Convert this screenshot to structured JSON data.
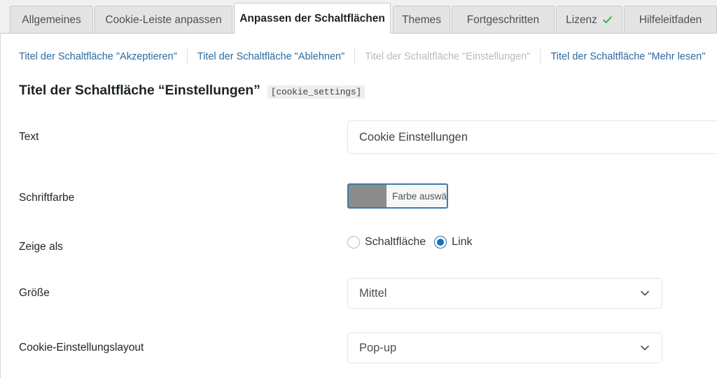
{
  "tabs": [
    {
      "label": "Allgemeines",
      "active": false,
      "icon": null
    },
    {
      "label": "Cookie-Leiste anpassen",
      "active": false,
      "icon": null
    },
    {
      "label": "Anpassen der Schaltflächen",
      "active": true,
      "icon": null
    },
    {
      "label": "Themes",
      "active": false,
      "icon": null
    },
    {
      "label": "Fortgeschritten",
      "active": false,
      "icon": null
    },
    {
      "label": "Lizenz",
      "active": false,
      "icon": "check-icon"
    },
    {
      "label": "Hilfeleitfaden",
      "active": false,
      "icon": null
    }
  ],
  "subnav": [
    {
      "label": "Titel der Schaltfläche \"Akzeptieren\"",
      "current": false
    },
    {
      "label": "Titel der Schaltfläche \"Ablehnen\"",
      "current": false
    },
    {
      "label": "Titel der Schaltfläche \"Einstellungen\"",
      "current": true
    },
    {
      "label": "Titel der Schaltfläche \"Mehr lesen\"",
      "current": false
    }
  ],
  "page": {
    "title": "Titel der Schaltfläche “Einstellungen”",
    "shortcode": "[cookie_settings]"
  },
  "form": {
    "text": {
      "label": "Text",
      "value": "Cookie Einstellungen",
      "placeholder": ""
    },
    "font_color": {
      "label": "Schriftfarbe",
      "button_label": "Farbe auswählen",
      "swatch_color": "#8c8c8c"
    },
    "display_as": {
      "label": "Zeige als",
      "options": [
        {
          "label": "Schaltfläche",
          "selected": false
        },
        {
          "label": "Link",
          "selected": true
        }
      ]
    },
    "size": {
      "label": "Größe",
      "value": "Mittel"
    },
    "settings_layout": {
      "label": "Cookie-Einstellungslayout",
      "value": "Pop-up"
    }
  },
  "colors": {
    "accent_blue": "#2271b1",
    "link_blue": "#2d6a9f",
    "check_green": "#46b450",
    "colorpicker_border": "#3a7ca5"
  }
}
